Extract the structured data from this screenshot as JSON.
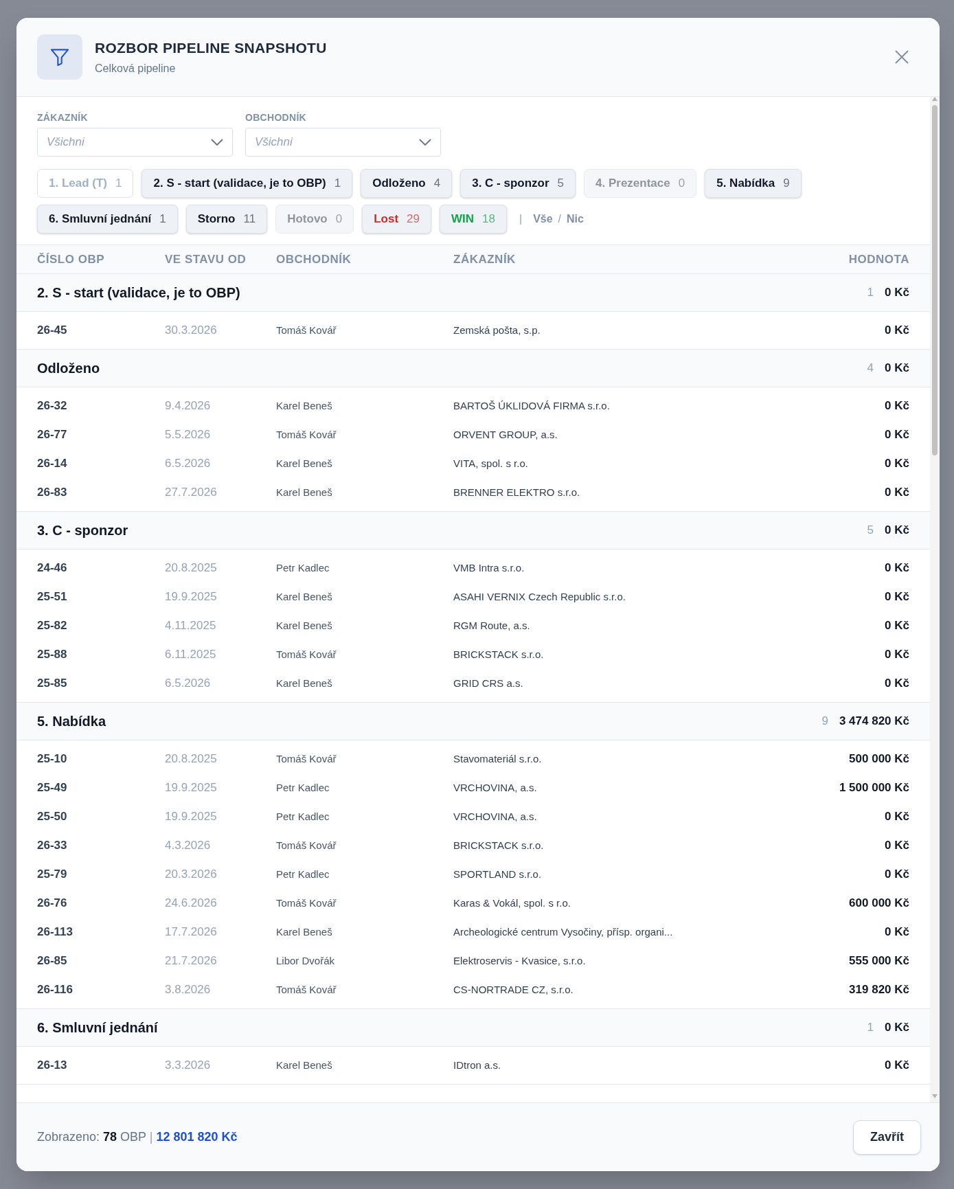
{
  "dialog": {
    "title": "ROZBOR PIPELINE SNAPSHOTU",
    "subtitle": "Celková pipeline"
  },
  "filters": [
    {
      "label": "ZÁKAZNÍK",
      "placeholder": "Všichni"
    },
    {
      "label": "OBCHODNÍK",
      "placeholder": "Všichni"
    }
  ],
  "chips": [
    {
      "label": "1. Lead (T)",
      "count": "1",
      "selected": false,
      "disabled": false
    },
    {
      "label": "2. S - start (validace, je to OBP)",
      "count": "1",
      "selected": true,
      "disabled": false
    },
    {
      "label": "Odloženo",
      "count": "4",
      "selected": true,
      "disabled": false
    },
    {
      "label": "3. C - sponzor",
      "count": "5",
      "selected": true,
      "disabled": false
    },
    {
      "label": "4. Prezentace",
      "count": "0",
      "selected": false,
      "disabled": true
    },
    {
      "label": "5. Nabídka",
      "count": "9",
      "selected": true,
      "disabled": false
    },
    {
      "label": "6. Smluvní jednání",
      "count": "1",
      "selected": true,
      "disabled": false
    },
    {
      "label": "Storno",
      "count": "11",
      "selected": true,
      "disabled": false
    },
    {
      "label": "Hotovo",
      "count": "0",
      "selected": false,
      "disabled": true
    },
    {
      "label": "Lost",
      "count": "29",
      "selected": true,
      "disabled": false,
      "color": "#dc2626"
    },
    {
      "label": "WIN",
      "count": "18",
      "selected": true,
      "disabled": false,
      "color": "#16a34a"
    }
  ],
  "chip_actions": {
    "separator": "|",
    "all": "Vše",
    "slash": "/",
    "none": "Nic"
  },
  "table": {
    "columns": [
      "ČÍSLO OBP",
      "VE STAVU OD",
      "OBCHODNÍK",
      "ZÁKAZNÍK",
      "HODNOTA"
    ],
    "groups": [
      {
        "name": "2. S - start (validace, je to OBP)",
        "count": "1",
        "total": "0 Kč",
        "rows": [
          [
            "26-45",
            "30.3.2026",
            "Tomáš Kovář",
            "Zemská pošta, s.p.",
            "0 Kč"
          ]
        ]
      },
      {
        "name": "Odloženo",
        "count": "4",
        "total": "0 Kč",
        "rows": [
          [
            "26-32",
            "9.4.2026",
            "Karel Beneš",
            "BARTOŠ ÚKLIDOVÁ FIRMA s.r.o.",
            "0 Kč"
          ],
          [
            "26-77",
            "5.5.2026",
            "Tomáš Kovář",
            "ORVENT GROUP, a.s.",
            "0 Kč"
          ],
          [
            "26-14",
            "6.5.2026",
            "Karel Beneš",
            "VITA, spol. s r.o.",
            "0 Kč"
          ],
          [
            "26-83",
            "27.7.2026",
            "Karel Beneš",
            "BRENNER ELEKTRO s.r.o.",
            "0 Kč"
          ]
        ]
      },
      {
        "name": "3. C - sponzor",
        "count": "5",
        "total": "0 Kč",
        "rows": [
          [
            "24-46",
            "20.8.2025",
            "Petr Kadlec",
            "VMB Intra s.r.o.",
            "0 Kč"
          ],
          [
            "25-51",
            "19.9.2025",
            "Karel Beneš",
            "ASAHI VERNIX Czech Republic s.r.o.",
            "0 Kč"
          ],
          [
            "25-82",
            "4.11.2025",
            "Karel Beneš",
            "RGM Route, a.s.",
            "0 Kč"
          ],
          [
            "25-88",
            "6.11.2025",
            "Tomáš Kovář",
            "BRICKSTACK s.r.o.",
            "0 Kč"
          ],
          [
            "25-85",
            "6.5.2026",
            "Karel Beneš",
            "GRID CRS a.s.",
            "0 Kč"
          ]
        ]
      },
      {
        "name": "5. Nabídka",
        "count": "9",
        "total": "3 474 820 Kč",
        "rows": [
          [
            "25-10",
            "20.8.2025",
            "Tomáš Kovář",
            "Stavomateriál s.r.o.",
            "500 000 Kč"
          ],
          [
            "25-49",
            "19.9.2025",
            "Petr Kadlec",
            "VRCHOVINA, a.s.",
            "1 500 000 Kč"
          ],
          [
            "25-50",
            "19.9.2025",
            "Petr Kadlec",
            "VRCHOVINA, a.s.",
            "0 Kč"
          ],
          [
            "26-33",
            "4.3.2026",
            "Tomáš Kovář",
            "BRICKSTACK s.r.o.",
            "0 Kč"
          ],
          [
            "25-79",
            "20.3.2026",
            "Petr Kadlec",
            "SPORTLAND s.r.o.",
            "0 Kč"
          ],
          [
            "26-76",
            "24.6.2026",
            "Tomáš Kovář",
            "Karas & Vokál, spol. s r.o.",
            "600 000 Kč"
          ],
          [
            "26-113",
            "17.7.2026",
            "Karel Beneš",
            "Archeologické centrum Vysočiny, přísp. organi...",
            "0 Kč"
          ],
          [
            "26-85",
            "21.7.2026",
            "Libor Dvořák",
            "Elektroservis - Kvasice, s.r.o.",
            "555 000 Kč"
          ],
          [
            "26-116",
            "3.8.2026",
            "Tomáš Kovář",
            "CS-NORTRADE CZ, s.r.o.",
            "319 820 Kč"
          ]
        ]
      },
      {
        "name": "6. Smluvní jednání",
        "count": "1",
        "total": "0 Kč",
        "rows": [
          [
            "26-13",
            "3.3.2026",
            "Karel Beneš",
            "IDtron a.s.",
            "0 Kč"
          ]
        ]
      }
    ]
  },
  "footer": {
    "label": "Zobrazeno:",
    "count": "78",
    "unit": "OBP",
    "separator": "|",
    "total": "12 801 820 Kč",
    "close": "Zavřít"
  }
}
